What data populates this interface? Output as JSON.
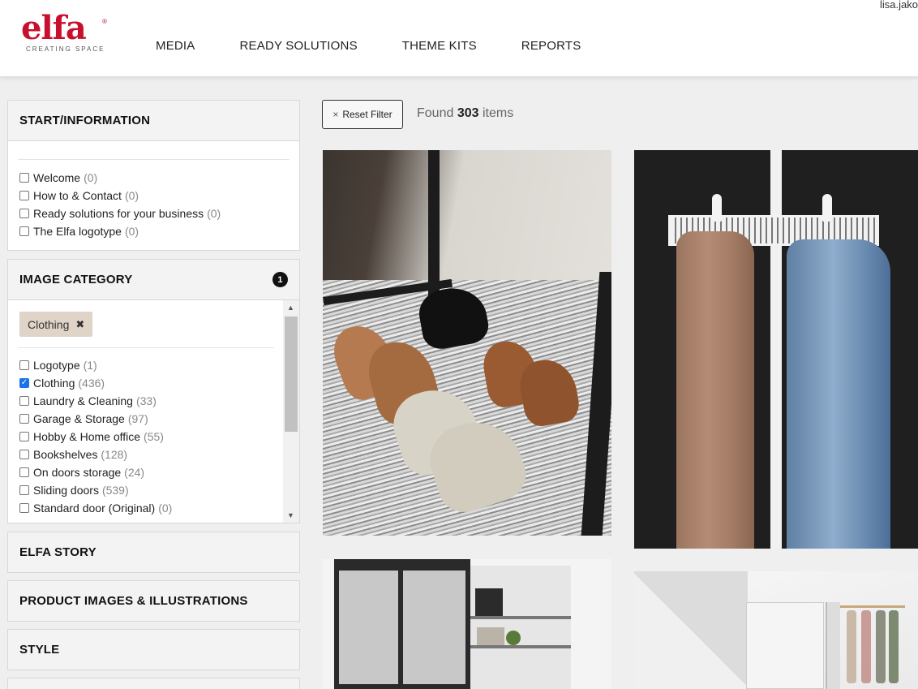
{
  "header": {
    "logo": {
      "word": "elfa",
      "tagline": "CREATING SPACE",
      "reg": "®"
    },
    "nav": [
      "MEDIA",
      "READY SOLUTIONS",
      "THEME KITS",
      "REPORTS"
    ],
    "user": "lisa.jako"
  },
  "sidebar": {
    "start": {
      "title": "START/INFORMATION",
      "options": [
        {
          "label": "Welcome",
          "count": "(0)",
          "checked": false
        },
        {
          "label": "How to & Contact",
          "count": "(0)",
          "checked": false
        },
        {
          "label": "Ready solutions for your business",
          "count": "(0)",
          "checked": false
        },
        {
          "label": "The Elfa logotype",
          "count": "(0)",
          "checked": false
        }
      ]
    },
    "category": {
      "title": "IMAGE CATEGORY",
      "badge": "1",
      "chip": "Clothing",
      "options": [
        {
          "label": "Logotype",
          "count": "(1)",
          "checked": false
        },
        {
          "label": "Clothing",
          "count": "(436)",
          "checked": true
        },
        {
          "label": "Laundry & Cleaning",
          "count": "(33)",
          "checked": false
        },
        {
          "label": "Garage & Storage",
          "count": "(97)",
          "checked": false
        },
        {
          "label": "Hobby & Home office",
          "count": "(55)",
          "checked": false
        },
        {
          "label": "Bookshelves",
          "count": "(128)",
          "checked": false
        },
        {
          "label": "On doors storage",
          "count": "(24)",
          "checked": false
        },
        {
          "label": "Sliding doors",
          "count": "(539)",
          "checked": false
        },
        {
          "label": "Standard door (Original)",
          "count": "(0)",
          "checked": false
        }
      ]
    },
    "sections": [
      "ELFA STORY",
      "PRODUCT IMAGES & ILLUSTRATIONS",
      "STYLE"
    ]
  },
  "main": {
    "reset_label": "Reset Filter",
    "found_prefix": "Found",
    "found_count": "303",
    "found_suffix": "items"
  },
  "icons": {
    "close": "×",
    "chip_close": "✖",
    "scroll_up": "▲",
    "scroll_down": "▼"
  }
}
